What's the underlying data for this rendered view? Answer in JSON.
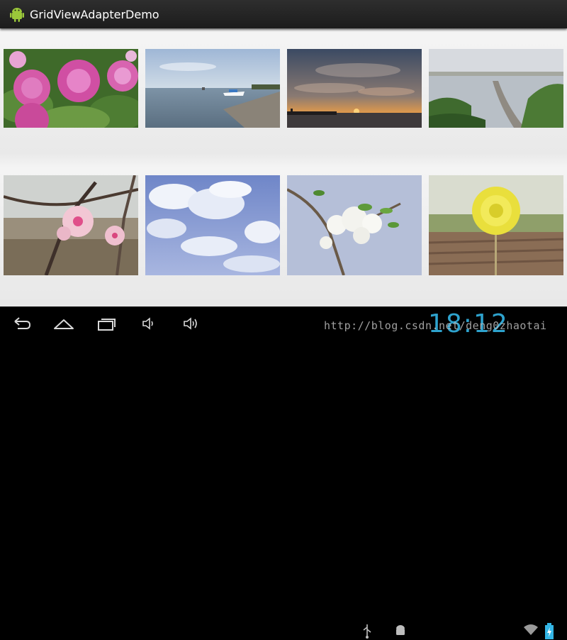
{
  "app": {
    "title": "GridViewAdapterDemo",
    "icon": "android-robot-icon"
  },
  "grid": {
    "items": [
      {
        "name": "pink-peony-photo"
      },
      {
        "name": "seaside-boat-photo"
      },
      {
        "name": "sunset-over-water-photo"
      },
      {
        "name": "coastal-spit-photo"
      },
      {
        "name": "peach-blossom-photo"
      },
      {
        "name": "cloudy-sky-photo"
      },
      {
        "name": "white-blossom-branch-photo"
      },
      {
        "name": "yellow-dandelion-photo"
      }
    ]
  },
  "navbar": {
    "buttons": [
      "back-icon",
      "home-icon",
      "recent-apps-icon",
      "volume-down-icon",
      "volume-up-icon"
    ]
  },
  "status": {
    "time": "18:12",
    "watermark": "http://blog.csdn.net/deng0zhaotai",
    "icons": [
      "usb-icon",
      "android-debug-icon",
      "wifi-icon",
      "battery-icon"
    ]
  },
  "colors": {
    "clock": "#33b5e5",
    "actionbar": "#222222"
  }
}
